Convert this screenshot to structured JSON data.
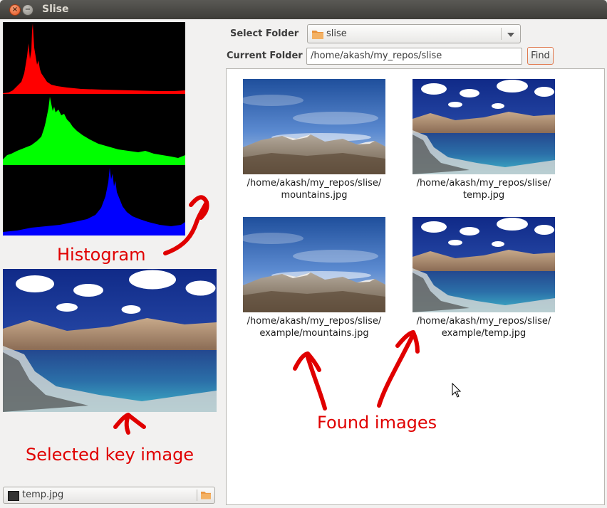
{
  "window": {
    "title": "Slise"
  },
  "histogram": {
    "channels": [
      {
        "name": "red",
        "color": "#ff0000"
      },
      {
        "name": "green",
        "color": "#00ff00"
      },
      {
        "name": "blue",
        "color": "#0000ff"
      }
    ]
  },
  "key_image": {
    "file_label": "temp.jpg"
  },
  "controls": {
    "select_folder_label": "Select Folder",
    "select_folder_value": "slise",
    "current_folder_label": "Current Folder",
    "current_folder_value": "/home/akash/my_repos/slise",
    "find_label": "Find"
  },
  "results": [
    {
      "line1": "/home/akash/my_repos/slise/",
      "line2": "mountains.jpg",
      "image": "mountains"
    },
    {
      "line1": "/home/akash/my_repos/slise/",
      "line2": "temp.jpg",
      "image": "lake"
    },
    {
      "line1": "/home/akash/my_repos/slise/",
      "line2": "example/mountains.jpg",
      "image": "mountains"
    },
    {
      "line1": "/home/akash/my_repos/slise/",
      "line2": "example/temp.jpg",
      "image": "lake"
    }
  ],
  "annotations": {
    "histogram": "Histogram",
    "key_image": "Selected key image",
    "found_images": "Found images"
  },
  "colors": {
    "annotation": "#e00000",
    "accent": "#e07a50"
  }
}
